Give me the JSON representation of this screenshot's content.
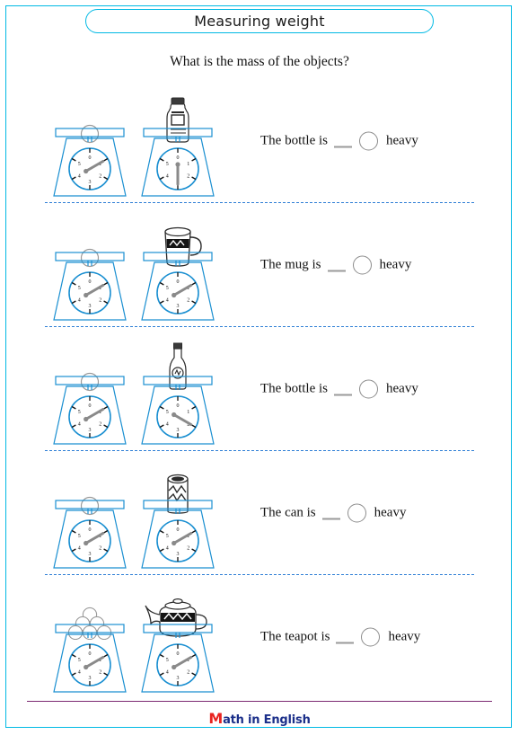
{
  "page": {
    "title": "Measuring weight",
    "subtitle": "What is the mass of the objects?",
    "border_color": "#00b9e4",
    "accent_color": "#00b9e4",
    "separator_color": "#2f7fd6"
  },
  "footer": {
    "logo_m": "M",
    "logo_rest": "ath in English",
    "rule_color": "#7d2a72",
    "logo_color": "#1b2f8a",
    "logo_accent_color": "#e8231f"
  },
  "dial": {
    "labels": [
      "0",
      "1",
      "2",
      "3",
      "4",
      "5"
    ],
    "face_color": "#1a8fd1",
    "needle_color": "#8a8a8a"
  },
  "rows": [
    {
      "object": "bottle-square",
      "left_scale": {
        "item": "empty-ring",
        "needle_value": "1"
      },
      "right_scale": {
        "item": "bottle-square",
        "needle_value": "3"
      },
      "statement": {
        "prefix": "The bottle is",
        "blank": "__",
        "unit_circle": "",
        "suffix": "heavy"
      }
    },
    {
      "object": "mug",
      "left_scale": {
        "item": "empty-ring",
        "needle_value": "1"
      },
      "right_scale": {
        "item": "mug",
        "needle_value": "1"
      },
      "statement": {
        "prefix": "The mug is",
        "blank": "__",
        "unit_circle": "",
        "suffix": "heavy"
      }
    },
    {
      "object": "bottle-slim",
      "left_scale": {
        "item": "empty-ring",
        "needle_value": "1"
      },
      "right_scale": {
        "item": "bottle-slim",
        "needle_value": "2"
      },
      "statement": {
        "prefix": "The bottle is",
        "blank": "__",
        "unit_circle": "",
        "suffix": "heavy"
      }
    },
    {
      "object": "can",
      "left_scale": {
        "item": "empty-ring",
        "needle_value": "1"
      },
      "right_scale": {
        "item": "can",
        "needle_value": "1"
      },
      "statement": {
        "prefix": "The can is",
        "blank": "__",
        "unit_circle": "",
        "suffix": "heavy"
      }
    },
    {
      "object": "teapot",
      "left_scale": {
        "item": "ball-pyramid",
        "needle_value": "1"
      },
      "right_scale": {
        "item": "teapot",
        "needle_value": "1"
      },
      "statement": {
        "prefix": "The teapot is",
        "blank": "__",
        "unit_circle": "",
        "suffix": "heavy"
      }
    }
  ]
}
